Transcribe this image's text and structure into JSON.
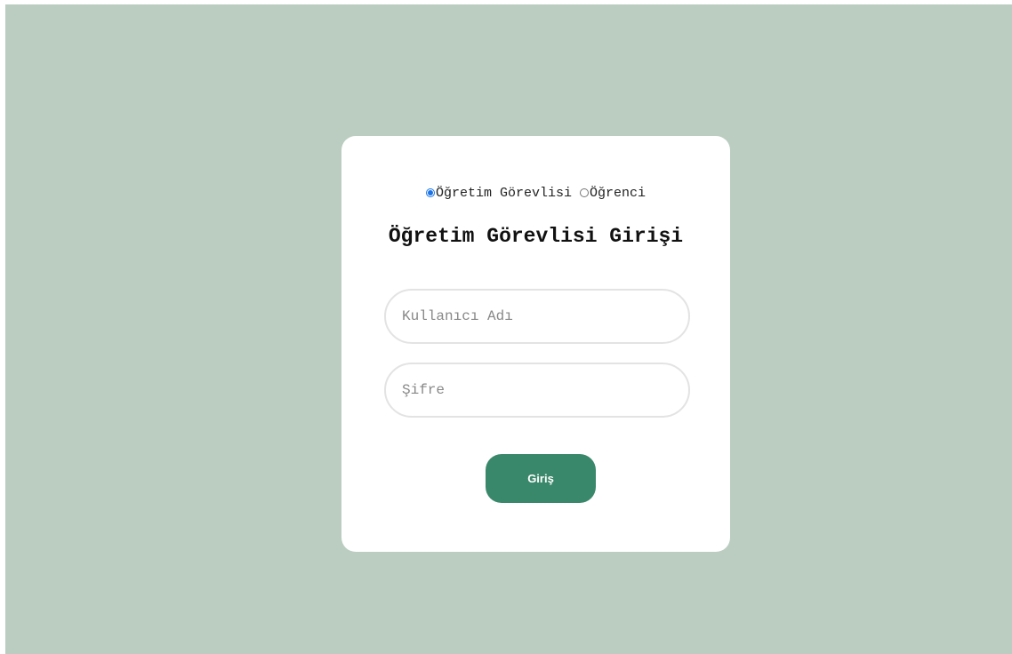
{
  "colors": {
    "background": "#bacdc0",
    "card": "#ffffff",
    "accent": "#3a886b",
    "radio_selected": "#1a73e8"
  },
  "role_selector": {
    "selected": "instructor",
    "options": [
      {
        "label": "Öğretim Görevlisi",
        "checked": true,
        "icon": "radio-checked-icon"
      },
      {
        "label": "Öğrenci",
        "checked": false,
        "icon": "radio-unchecked-icon"
      }
    ]
  },
  "login": {
    "title": "Öğretim Görevlisi Girişi",
    "username_placeholder": "Kullanıcı Adı",
    "username_value": "",
    "password_placeholder": "Şifre",
    "password_value": "",
    "submit_label": "Giriş"
  }
}
